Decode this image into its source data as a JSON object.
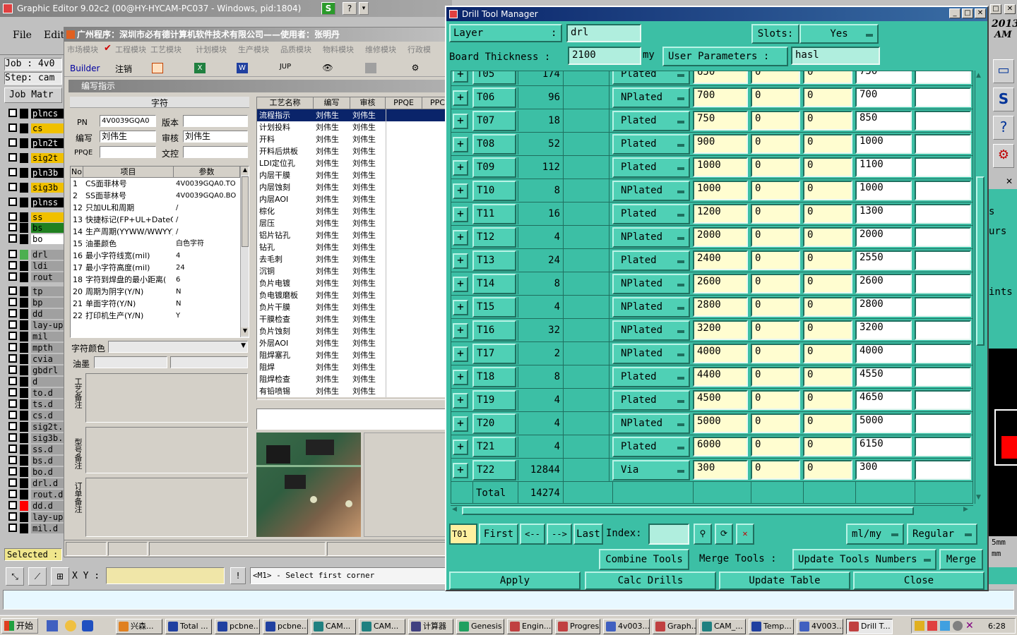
{
  "graphic_editor": {
    "title": "Graphic Editor 9.02c2 (00@HY-HYCAM-PC037 - Windows, pid:1804)",
    "menu_file": "File",
    "menu_edit": "Edit",
    "job_label": "Job : 4v0",
    "step_label": "Step: cam",
    "job_matrix": "Job Matr",
    "layers": [
      {
        "name": "plncs",
        "color": "#000000",
        "text": "#ffffff"
      },
      {
        "name": "cs",
        "color": "#f0c000",
        "text": "#000000"
      },
      {
        "name": "pln2t",
        "color": "#000000",
        "text": "#ffffff"
      },
      {
        "name": "sig2t",
        "color": "#f0c000",
        "text": "#000000"
      },
      {
        "name": "pln3b",
        "color": "#000000",
        "text": "#ffffff"
      },
      {
        "name": "sig3b",
        "color": "#f0c000",
        "text": "#000000"
      },
      {
        "name": "plnss",
        "color": "#000000",
        "text": "#ffffff"
      },
      {
        "name": "ss",
        "color": "#f0c000",
        "text": "#000000"
      },
      {
        "name": "bs",
        "color": "#208020",
        "text": "#000000"
      },
      {
        "name": "bo",
        "color": "#ffffff",
        "text": "#000000"
      },
      {
        "name": "drl",
        "color": "#a0a0a0",
        "text": "#000000"
      },
      {
        "name": "ldi",
        "color": "#a0a0a0",
        "text": "#000000"
      },
      {
        "name": "rout",
        "color": "#a0a0a0",
        "text": "#000000"
      },
      {
        "name": "tp",
        "color": "#a0a0a0",
        "text": "#000000"
      },
      {
        "name": "bp",
        "color": "#a0a0a0",
        "text": "#000000"
      },
      {
        "name": "dd",
        "color": "#a0a0a0",
        "text": "#000000"
      },
      {
        "name": "lay-up",
        "color": "#a0a0a0",
        "text": "#000000"
      },
      {
        "name": "mil",
        "color": "#a0a0a0",
        "text": "#000000"
      },
      {
        "name": "mpth",
        "color": "#a0a0a0",
        "text": "#000000"
      },
      {
        "name": "cvia",
        "color": "#a0a0a0",
        "text": "#000000"
      },
      {
        "name": "gbdrl",
        "color": "#a0a0a0",
        "text": "#000000"
      },
      {
        "name": "d",
        "color": "#a0a0a0",
        "text": "#000000"
      },
      {
        "name": "to.d",
        "color": "#a0a0a0",
        "text": "#000000"
      },
      {
        "name": "ts.d",
        "color": "#a0a0a0",
        "text": "#000000"
      },
      {
        "name": "cs.d",
        "color": "#a0a0a0",
        "text": "#000000"
      },
      {
        "name": "sig2t.",
        "color": "#a0a0a0",
        "text": "#000000"
      },
      {
        "name": "sig3b.",
        "color": "#a0a0a0",
        "text": "#000000"
      },
      {
        "name": "ss.d",
        "color": "#a0a0a0",
        "text": "#000000"
      },
      {
        "name": "bs.d",
        "color": "#a0a0a0",
        "text": "#000000"
      },
      {
        "name": "bo.d",
        "color": "#a0a0a0",
        "text": "#000000"
      },
      {
        "name": "drl.d",
        "color": "#a0a0a0",
        "text": "#000000"
      },
      {
        "name": "rout.d",
        "color": "#a0a0a0",
        "text": "#000000"
      },
      {
        "name": "dd.d",
        "color": "#a0a0a0",
        "text": "#000000"
      },
      {
        "name": "lay-up",
        "color": "#a0a0a0",
        "text": "#000000"
      },
      {
        "name": "mil.d",
        "color": "#a0a0a0",
        "text": "#000000"
      }
    ],
    "selected_label": "Selected :",
    "xy_label": "X Y :",
    "prompt": "<M1> - Select first corner",
    "right_year": "2013",
    "right_am": "AM",
    "right_s": "s",
    "right_urs": "urs",
    "right_ints": "ints",
    "right_5mm": "5mm",
    "right_mm": "mm"
  },
  "chinese_window": {
    "title": "广州程序：深圳市必有德计算机软件技术有限公司——使用者：张明丹",
    "modules": [
      "市场模块",
      "工程模块",
      "工艺模块",
      "计划模块",
      "生产模块",
      "品质模块",
      "物料模块",
      "维修模块",
      "行政模"
    ],
    "toolbar_builder": "Builder",
    "toolbar_cancel": "注销",
    "panel_title": "编写指示",
    "section_title": "字符",
    "pn_label": "PN",
    "pn_value": "4V0039GQA0",
    "version_label": "版本",
    "author_label": "编写",
    "author_value": "刘伟生",
    "reviewer_label": "审核",
    "reviewer_value": "刘伟生",
    "ppqe_label": "PPQE",
    "control_label": "文控",
    "params_headers": [
      "No",
      "项目",
      "参数"
    ],
    "params": [
      [
        "1",
        "CS面菲林号",
        "4V0039GQA0.TO"
      ],
      [
        "2",
        "SS面菲林号",
        "4V0039GQA0.BO"
      ],
      [
        "12",
        "只加UL和周期",
        "/"
      ],
      [
        "13",
        "快捷标记(FP+UL+DateCo",
        "/"
      ],
      [
        "14",
        "生产周期(YYWW/WWYY)",
        "/"
      ],
      [
        "15",
        "油墨颜色",
        "白色字符"
      ],
      [
        "16",
        "最小字符线宽(mil)",
        "4"
      ],
      [
        "17",
        "最小字符高度(mil)",
        "24"
      ],
      [
        "18",
        "字符到焊盘的最小距离(",
        "6"
      ],
      [
        "20",
        "周期为阴字(Y/N)",
        "N"
      ],
      [
        "21",
        "单面字符(Y/N)",
        "N"
      ],
      [
        "22",
        "打印机生产(Y/N)",
        "Y"
      ]
    ],
    "char_color_label": "字符颜色",
    "ink_label": "油墨",
    "note1_label": "工艺备注",
    "note2_label": "型号备注",
    "note3_label": "订单备注",
    "process_headers": [
      "工艺名称",
      "编写",
      "审核",
      "PPQE",
      "PPC"
    ],
    "processes": [
      "流程指示",
      "计划投料",
      "开料",
      "开料后烘板",
      "LDI定位孔",
      "内层干膜",
      "内层蚀刻",
      "内层AOI",
      "棕化",
      "层压",
      "铝片钻孔",
      "钻孔",
      "去毛刺",
      "沉铜",
      "负片电镀",
      "负电镀磨板",
      "负片干膜",
      "干膜检查",
      "负片蚀刻",
      "外层AOI",
      "阻焊塞孔",
      "阻焊",
      "阻焊检查",
      "有铅喷锡"
    ],
    "process_person": "刘伟生"
  },
  "drill_tool_manager": {
    "title": "Drill Tool Manager",
    "layer_label": "Layer",
    "layer_value": "drl",
    "slots_label": "Slots:",
    "slots_value": "Yes",
    "board_thickness_label": "Board Thickness :",
    "board_thickness_value": "2100",
    "unit_label": "my",
    "user_params_label": "User Parameters :",
    "user_params_value": "hasl",
    "rows": [
      {
        "tool": "T05",
        "count": "174",
        "type": "Plated",
        "size": "650",
        "p1": "0",
        "p2": "0",
        "finish": "750"
      },
      {
        "tool": "T06",
        "count": "96",
        "type": "NPlated",
        "size": "700",
        "p1": "0",
        "p2": "0",
        "finish": "700"
      },
      {
        "tool": "T07",
        "count": "18",
        "type": "Plated",
        "size": "750",
        "p1": "0",
        "p2": "0",
        "finish": "850"
      },
      {
        "tool": "T08",
        "count": "52",
        "type": "Plated",
        "size": "900",
        "p1": "0",
        "p2": "0",
        "finish": "1000"
      },
      {
        "tool": "T09",
        "count": "112",
        "type": "Plated",
        "size": "1000",
        "p1": "0",
        "p2": "0",
        "finish": "1100"
      },
      {
        "tool": "T10",
        "count": "8",
        "type": "NPlated",
        "size": "1000",
        "p1": "0",
        "p2": "0",
        "finish": "1000"
      },
      {
        "tool": "T11",
        "count": "16",
        "type": "Plated",
        "size": "1200",
        "p1": "0",
        "p2": "0",
        "finish": "1300"
      },
      {
        "tool": "T12",
        "count": "4",
        "type": "NPlated",
        "size": "2000",
        "p1": "0",
        "p2": "0",
        "finish": "2000"
      },
      {
        "tool": "T13",
        "count": "24",
        "type": "Plated",
        "size": "2400",
        "p1": "0",
        "p2": "0",
        "finish": "2550"
      },
      {
        "tool": "T14",
        "count": "8",
        "type": "NPlated",
        "size": "2600",
        "p1": "0",
        "p2": "0",
        "finish": "2600"
      },
      {
        "tool": "T15",
        "count": "4",
        "type": "NPlated",
        "size": "2800",
        "p1": "0",
        "p2": "0",
        "finish": "2800"
      },
      {
        "tool": "T16",
        "count": "32",
        "type": "NPlated",
        "size": "3200",
        "p1": "0",
        "p2": "0",
        "finish": "3200"
      },
      {
        "tool": "T17",
        "count": "2",
        "type": "NPlated",
        "size": "4000",
        "p1": "0",
        "p2": "0",
        "finish": "4000"
      },
      {
        "tool": "T18",
        "count": "8",
        "type": "Plated",
        "size": "4400",
        "p1": "0",
        "p2": "0",
        "finish": "4550"
      },
      {
        "tool": "T19",
        "count": "4",
        "type": "Plated",
        "size": "4500",
        "p1": "0",
        "p2": "0",
        "finish": "4650"
      },
      {
        "tool": "T20",
        "count": "4",
        "type": "NPlated",
        "size": "5000",
        "p1": "0",
        "p2": "0",
        "finish": "5000"
      },
      {
        "tool": "T21",
        "count": "4",
        "type": "Plated",
        "size": "6000",
        "p1": "0",
        "p2": "0",
        "finish": "6150"
      },
      {
        "tool": "T22",
        "count": "12844",
        "type": "Via",
        "size": "300",
        "p1": "0",
        "p2": "0",
        "finish": "300"
      }
    ],
    "total_label": "Total",
    "total_value": "14274",
    "current_tool": "T01",
    "first_label": "First",
    "prev_label": "<--",
    "next_label": "-->",
    "last_label": "Last",
    "index_label": "Index:",
    "units_option": "ml/my",
    "mode_option": "Regular",
    "combine_tools": "Combine Tools",
    "merge_tools_label": "Merge Tools :",
    "update_numbers": "Update Tools Numbers",
    "merge": "Merge",
    "apply": "Apply",
    "calc_drills": "Calc Drills",
    "update_table": "Update Table",
    "close": "Close"
  },
  "taskbar": {
    "start": "开始",
    "tasks": [
      "兴森...",
      "Total ...",
      "pcbne...",
      "pcbne...",
      "CAM...",
      "CAM...",
      "计算器",
      "Genesis",
      "Engin...",
      "Progress",
      "4v003...",
      "Graph...",
      "CAM_...",
      "Temp...",
      "4V003...",
      "Drill T..."
    ],
    "clock": "6:28"
  }
}
